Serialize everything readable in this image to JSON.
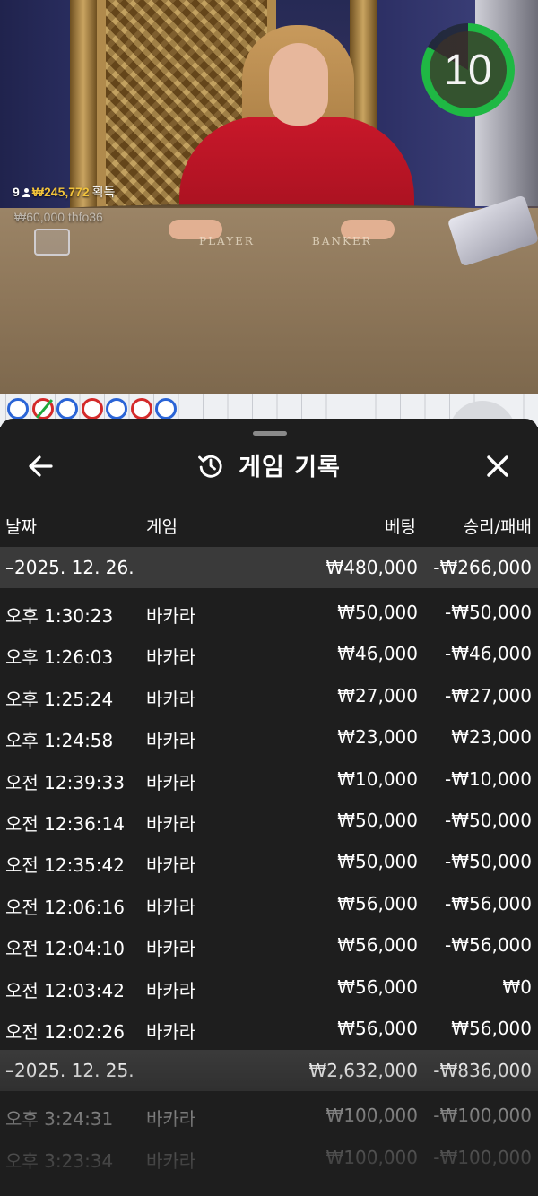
{
  "live": {
    "timer": "10",
    "winners": {
      "count": "9",
      "amount": "₩245,772",
      "label": "획득"
    },
    "last_winner": "₩60,000  thfo36",
    "table_labels": {
      "player": "PLAYER",
      "banker": "BANKER"
    }
  },
  "bead_road": {
    "beads": [
      {
        "color": "blue",
        "tie": false
      },
      {
        "color": "red",
        "tie": true
      },
      {
        "color": "blue",
        "tie": false
      },
      {
        "color": "red",
        "tie": false
      },
      {
        "color": "blue",
        "tie": false
      },
      {
        "color": "red",
        "tie": false
      },
      {
        "color": "blue",
        "tie": false
      }
    ],
    "colors": {
      "blue": "#2a64d6",
      "red": "#d42a2a",
      "tie": "#1fa83a"
    }
  },
  "history": {
    "title": "게임 기록",
    "back_icon": "arrow-left-icon",
    "close_icon": "close-icon",
    "title_icon": "history-icon",
    "columns": {
      "date": "날짜",
      "game": "게임",
      "bet": "베팅",
      "result": "승리/패배"
    },
    "days": [
      {
        "date": "–2025. 12. 26.",
        "bet_total": "₩480,000",
        "result_total": "-₩266,000",
        "games": [
          {
            "time": "오후 1:30:23",
            "game": "바카라",
            "bet": "₩50,000",
            "result": "-₩50,000"
          },
          {
            "time": "오후 1:26:03",
            "game": "바카라",
            "bet": "₩46,000",
            "result": "-₩46,000"
          },
          {
            "time": "오후 1:25:24",
            "game": "바카라",
            "bet": "₩27,000",
            "result": "-₩27,000"
          },
          {
            "time": "오후 1:24:58",
            "game": "바카라",
            "bet": "₩23,000",
            "result": "₩23,000"
          },
          {
            "time": "오전 12:39:33",
            "game": "바카라",
            "bet": "₩10,000",
            "result": "-₩10,000"
          },
          {
            "time": "오전 12:36:14",
            "game": "바카라",
            "bet": "₩50,000",
            "result": "-₩50,000"
          },
          {
            "time": "오전 12:35:42",
            "game": "바카라",
            "bet": "₩50,000",
            "result": "-₩50,000"
          },
          {
            "time": "오전 12:06:16",
            "game": "바카라",
            "bet": "₩56,000",
            "result": "-₩56,000"
          },
          {
            "time": "오전 12:04:10",
            "game": "바카라",
            "bet": "₩56,000",
            "result": "-₩56,000"
          },
          {
            "time": "오전 12:03:42",
            "game": "바카라",
            "bet": "₩56,000",
            "result": "₩0"
          },
          {
            "time": "오전 12:02:26",
            "game": "바카라",
            "bet": "₩56,000",
            "result": "₩56,000"
          }
        ]
      },
      {
        "date": "–2025. 12. 25.",
        "bet_total": "₩2,632,000",
        "result_total": "-₩836,000",
        "games": [
          {
            "time": "오후 3:24:31",
            "game": "바카라",
            "bet": "₩100,000",
            "result": "-₩100,000"
          },
          {
            "time": "오후 3:23:34",
            "game": "바카라",
            "bet": "₩100,000",
            "result": "-₩100,000"
          }
        ]
      }
    ]
  }
}
